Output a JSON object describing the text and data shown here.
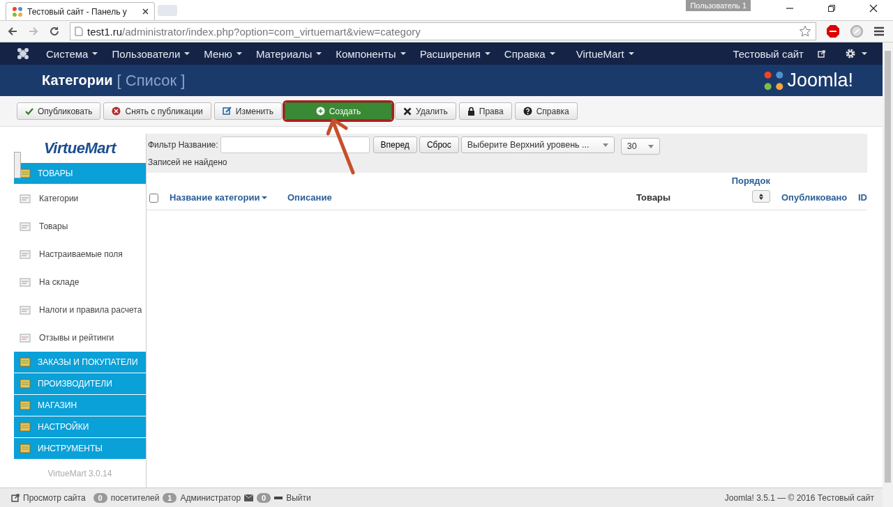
{
  "browser": {
    "tab_title": "Тестовый сайт - Панель у",
    "profile": "Пользователь 1",
    "url_host": "test1.ru",
    "url_path": "/administrator/index.php?option=com_virtuemart&view=category"
  },
  "nav": {
    "items": [
      {
        "label": "Система"
      },
      {
        "label": "Пользователи"
      },
      {
        "label": "Меню"
      },
      {
        "label": "Материалы"
      },
      {
        "label": "Компоненты"
      },
      {
        "label": "Расширения"
      },
      {
        "label": "Справка"
      },
      {
        "label": "VirtueMart"
      }
    ],
    "site_link": "Тестовый сайт"
  },
  "header": {
    "title": "Категории",
    "subtitle": "[ Список ]",
    "logo": "Joomla!"
  },
  "toolbar": [
    {
      "label": "Опубликовать",
      "kind": "check",
      "highlighted": false
    },
    {
      "label": "Снять с публикации",
      "kind": "cancel",
      "highlighted": false
    },
    {
      "label": "Изменить",
      "kind": "edit",
      "highlighted": false
    },
    {
      "label": "Создать",
      "kind": "new",
      "highlighted": true
    },
    {
      "label": "Удалить",
      "kind": "delete",
      "highlighted": false
    },
    {
      "label": "Права",
      "kind": "lock",
      "highlighted": false
    },
    {
      "label": "Справка",
      "kind": "help",
      "highlighted": false
    }
  ],
  "sidebar": {
    "logo": "VirtueMart",
    "sections": [
      {
        "title": "ТОВАРЫ",
        "items": [
          "Категории",
          "Товары",
          "Настраиваемые поля",
          "На складе",
          "Налоги и правила расчета",
          "Отзывы и рейтинги"
        ]
      },
      {
        "title": "ЗАКАЗЫ И ПОКУПАТЕЛИ"
      },
      {
        "title": "ПРОИЗВОДИТЕЛИ"
      },
      {
        "title": "МАГАЗИН"
      },
      {
        "title": "НАСТРОЙКИ"
      },
      {
        "title": "ИНСТРУМЕНТЫ"
      }
    ],
    "version": "VirtueMart 3.0.14"
  },
  "filter": {
    "label": "Фильтр Название:",
    "go": "Вперед",
    "reset": "Сброс",
    "parent_select": "Выберите Верхний уровень ...",
    "limit_select": "30",
    "message": "Записей не найдено"
  },
  "table": {
    "select_all_checked": false,
    "columns": [
      {
        "label": "Название категории",
        "kind": "sorted"
      },
      {
        "label": "Описание",
        "kind": "link"
      },
      {
        "label": "Товары",
        "kind": "plain"
      },
      {
        "label": "Порядок",
        "kind": "ordering"
      },
      {
        "label": "Опубликовано",
        "kind": "link"
      },
      {
        "label": "ID",
        "kind": "link"
      }
    ]
  },
  "status_bar": {
    "view_site": "Просмотр сайта",
    "visitors_count": "0",
    "visitors": "посетителей",
    "admins_count": "1",
    "admins": "Администратор",
    "messages_count": "0",
    "logout": "Выйти",
    "copyright": "Joomla! 3.5.1  —  © 2016 Тестовый сайт"
  }
}
